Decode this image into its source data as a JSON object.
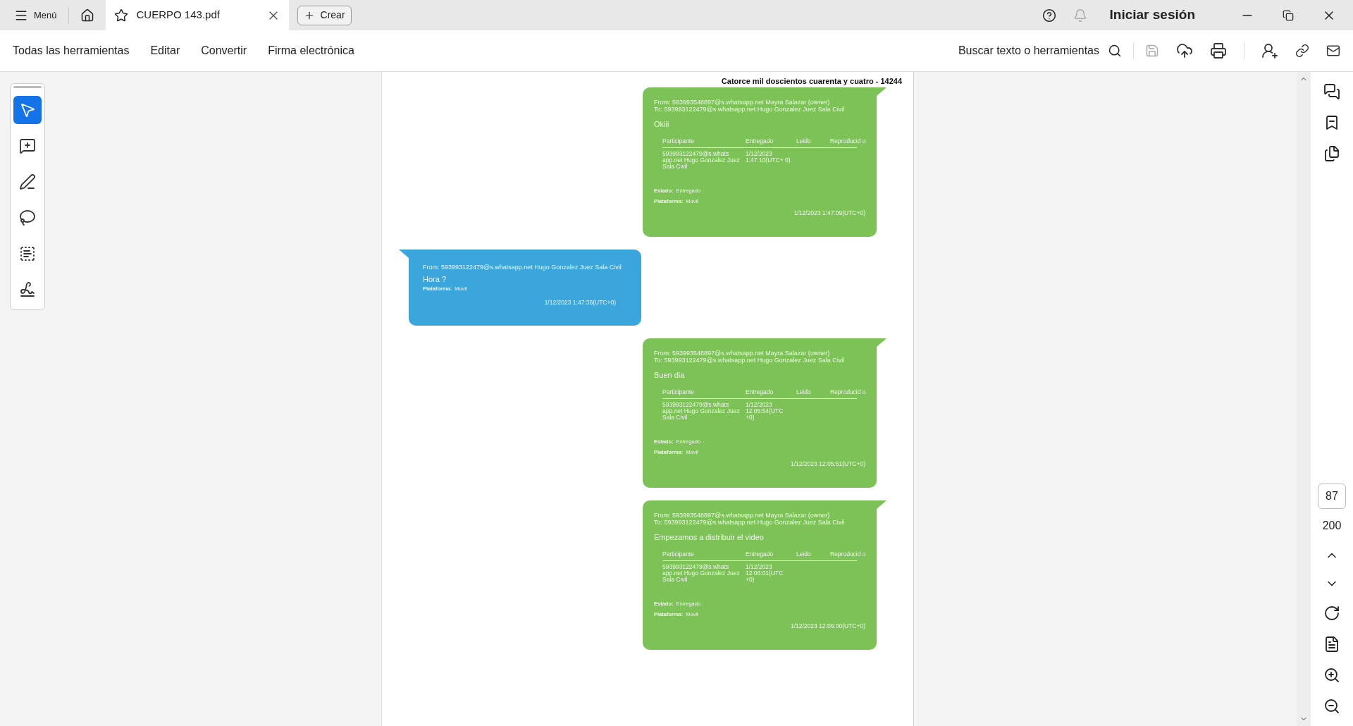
{
  "title_bar": {
    "menu_label": "Menú",
    "tab": {
      "title": "CUERPO 143.pdf"
    },
    "create_label": "Crear",
    "sign_in": "Iniciar sesión"
  },
  "toolbar": {
    "items": [
      "Todas las herramientas",
      "Editar",
      "Convertir",
      "Firma electrónica"
    ],
    "search_label": "Buscar texto o herramientas"
  },
  "tools": [
    {
      "kind": "select",
      "selected": true
    },
    {
      "kind": "comment",
      "selected": false
    },
    {
      "kind": "draw",
      "selected": false
    },
    {
      "kind": "lasso",
      "selected": false
    },
    {
      "kind": "text",
      "selected": false
    },
    {
      "kind": "sign",
      "selected": false
    }
  ],
  "page": {
    "header": "Catorce mil doscientos cuarenta y cuatro - 14244",
    "messages": [
      {
        "kind": "outgoing",
        "from": "From: 593993548897@s.whatsapp.net Mayra Salazar (owner)",
        "to": "To: 593993122479@s.whatsapp.net Hugo Gonzalez Juez Sala Civil",
        "body": "Okiii",
        "columns": [
          "Participante",
          "Entregado",
          "Leido",
          "Reproducid o"
        ],
        "participant": "593993122479@s.whats app.net Hugo Gonzalez Juez Sala Civil",
        "delivered": "1/12/2023 1:47:10(UTC+ 0)",
        "status_label": "Estado:",
        "status": "Entregado",
        "platform_label": "Plataforma:",
        "platform": "Movil",
        "time": "1/12/2023 1:47:09(UTC+0)"
      },
      {
        "kind": "incoming",
        "from": "From: 593993122479@s.whatsapp.net Hugo Gonzalez Juez Sala Civil",
        "body": "Hora ?",
        "platform_label": "Plataforma:",
        "platform": "Movil",
        "time": "1/12/2023 1:47:36(UTC+0)"
      },
      {
        "kind": "outgoing",
        "from": "From: 593993548897@s.whatsapp.net Mayra Salazar (owner)",
        "to": "To: 593993122479@s.whatsapp.net Hugo Gonzalez Juez Sala Civil",
        "body": "Buen dia",
        "columns": [
          "Participante",
          "Entregado",
          "Leido",
          "Reproducid o"
        ],
        "participant": "593993122479@s.whats app.net Hugo Gonzalez Juez Sala Civil",
        "delivered": "1/12/2023 12:05:54(UTC +0)",
        "status_label": "Estado:",
        "status": "Entregado",
        "platform_label": "Plataforma:",
        "platform": "Movil",
        "time": "1/12/2023 12:05:51(UTC+0)"
      },
      {
        "kind": "outgoing",
        "from": "From: 593993548897@s.whatsapp.net Mayra Salazar (owner)",
        "to": "To: 593993122479@s.whatsapp.net Hugo Gonzalez Juez Sala Civil",
        "body": "Empezamos a distribuir el video",
        "columns": [
          "Participante",
          "Entregado",
          "Leido",
          "Reproducid o"
        ],
        "participant": "593993122479@s.whats app.net Hugo Gonzalez Juez Sala Civil",
        "delivered": "1/12/2023 12:06:01(UTC +0)",
        "status_label": "Estado:",
        "status": "Entregado",
        "platform_label": "Plataforma:",
        "platform": "Movil",
        "time": "1/12/2023 12:06:00(UTC+0)"
      }
    ]
  },
  "page_nav": {
    "current": "87",
    "total": "200"
  }
}
